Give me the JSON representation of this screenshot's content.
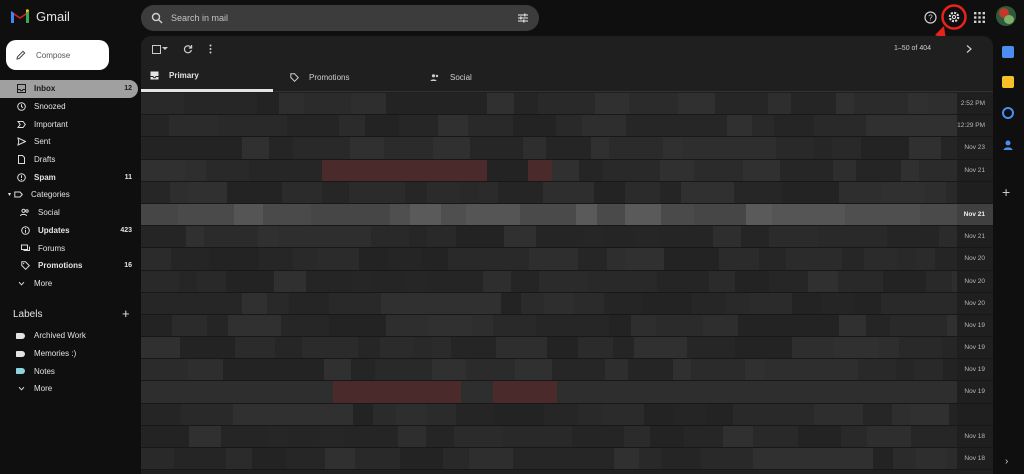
{
  "app": {
    "logo_text": "Gmail"
  },
  "search": {
    "placeholder": "Search in mail"
  },
  "header_icons": [
    "tune-icon",
    "help-icon",
    "settings-icon",
    "apps-grid-icon",
    "account-avatar"
  ],
  "compose": {
    "label": "Compose"
  },
  "nav": [
    {
      "label": "Inbox",
      "count": "12",
      "icon": "inbox-icon",
      "active": true
    },
    {
      "label": "Snoozed",
      "count": "",
      "icon": "clock-icon"
    },
    {
      "label": "Important",
      "count": "",
      "icon": "important-icon"
    },
    {
      "label": "Sent",
      "count": "",
      "icon": "send-icon"
    },
    {
      "label": "Drafts",
      "count": "",
      "icon": "draft-icon"
    },
    {
      "label": "Spam",
      "count": "11",
      "icon": "spam-icon",
      "bold": true
    },
    {
      "label": "Categories",
      "count": "",
      "icon": "label-icon"
    },
    {
      "label": "Social",
      "count": "",
      "icon": "people-icon"
    },
    {
      "label": "Updates",
      "count": "423",
      "icon": "info-icon",
      "bold": true
    },
    {
      "label": "Forums",
      "count": "",
      "icon": "forum-icon"
    },
    {
      "label": "Promotions",
      "count": "16",
      "icon": "tag-icon",
      "bold": true
    },
    {
      "label": "More",
      "count": "",
      "icon": "chevron-down-icon"
    }
  ],
  "labels": {
    "title": "Labels",
    "items": [
      {
        "label": "Archived Work",
        "color": "#e3e3e3"
      },
      {
        "label": "Memories :)",
        "color": "#e3e3e3"
      },
      {
        "label": "Notes",
        "color": "#8fd3e0"
      },
      {
        "label": "More",
        "color": ""
      }
    ]
  },
  "toolbar": {
    "pager": "1–50 of 404"
  },
  "tabs": [
    {
      "label": "Primary",
      "icon": "inbox-icon",
      "active": true
    },
    {
      "label": "Promotions",
      "icon": "tag-icon"
    },
    {
      "label": "Social",
      "icon": "people-icon"
    }
  ],
  "emails": [
    {
      "date": "2:52 PM",
      "unread": false
    },
    {
      "date": "12:29 PM",
      "unread": false
    },
    {
      "date": "Nov 23",
      "unread": false
    },
    {
      "date": "Nov 21",
      "unread": false
    },
    {
      "date": "",
      "unread": false
    },
    {
      "date": "Nov 21",
      "unread": true
    },
    {
      "date": "Nov 21",
      "unread": false
    },
    {
      "date": "Nov 20",
      "unread": false
    },
    {
      "date": "Nov 20",
      "unread": false
    },
    {
      "date": "Nov 20",
      "unread": false
    },
    {
      "date": "Nov 19",
      "unread": false
    },
    {
      "date": "Nov 19",
      "unread": false
    },
    {
      "date": "Nov 19",
      "unread": false
    },
    {
      "date": "Nov 19",
      "unread": false
    },
    {
      "date": "",
      "unread": false
    },
    {
      "date": "Nov 18",
      "unread": false
    },
    {
      "date": "Nov 18",
      "unread": false
    }
  ],
  "colors": {
    "accent_red": "#d93025",
    "background": "#0f0f0f",
    "panel": "#1f1f1f"
  }
}
